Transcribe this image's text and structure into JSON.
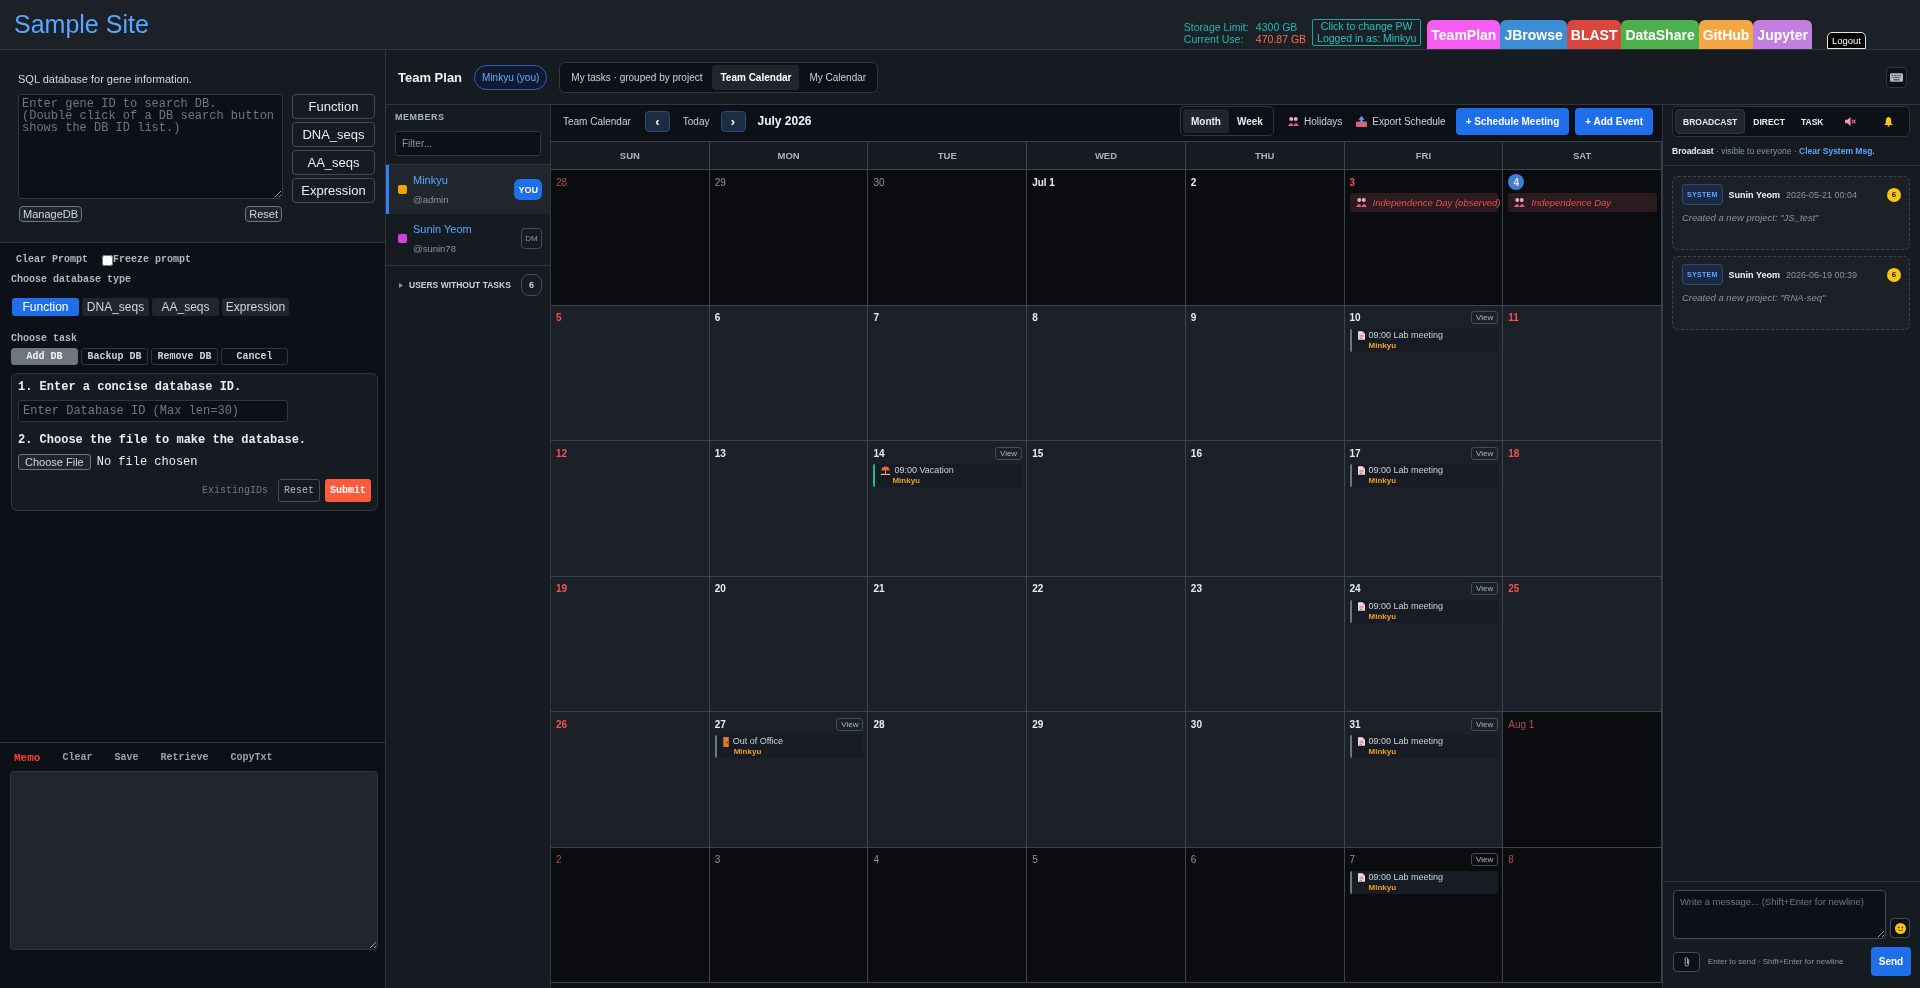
{
  "header": {
    "title": "Sample Site",
    "storage": [
      {
        "label": "Storage Limit:",
        "value": "4300 GB",
        "kind": "limit"
      },
      {
        "label": "Current Use:",
        "value": "470.87 GB",
        "kind": "use"
      }
    ],
    "account": {
      "action": "Click to change PW",
      "user": "Logged in as: Minkyu"
    },
    "apps": [
      {
        "label": "TeamPlan",
        "color": "#f55cf0"
      },
      {
        "label": "JBrowse",
        "color": "#3c8dd4"
      },
      {
        "label": "BLAST",
        "color": "#d9463e"
      },
      {
        "label": "DataShare",
        "color": "#4cb04c"
      },
      {
        "label": "GitHub",
        "color": "#f4a742"
      },
      {
        "label": "Jupyter",
        "color": "#c27fe0"
      }
    ],
    "logout": "Logout"
  },
  "gene_db": {
    "description": "SQL database for gene information.",
    "search": {
      "placeholder": "Enter gene ID to search DB.\n(Double click of a DB search button shows the DB ID list.)"
    },
    "search_buttons": [
      "Function",
      "DNA_seqs",
      "AA_seqs",
      "Expression"
    ],
    "manage": "ManageDB",
    "reset": "Reset"
  },
  "prompt_controls": {
    "clear": "Clear Prompt",
    "freeze": {
      "label": "Freeze prompt",
      "checked": false
    }
  },
  "db_type": {
    "label": "Choose database type",
    "options": [
      {
        "label": "Function",
        "selected": true
      },
      {
        "label": "DNA_seqs",
        "selected": false
      },
      {
        "label": "AA_seqs",
        "selected": false
      },
      {
        "label": "Expression",
        "selected": false
      }
    ]
  },
  "task": {
    "label": "Choose task",
    "options": [
      {
        "label": "Add DB",
        "selected": true
      },
      {
        "label": "Backup DB",
        "selected": false
      },
      {
        "label": "Remove DB",
        "selected": false
      },
      {
        "label": "Cancel",
        "selected": false
      }
    ]
  },
  "add_form": {
    "step_1": "1. Enter a concise database ID.",
    "id_field": {
      "placeholder": "Enter Database ID (Max len=30)"
    },
    "step_2": "2. Choose the file to make the database.",
    "file_button": "Choose File",
    "file_status": "No file chosen",
    "existing_ids": "ExistingIDs",
    "reset": "Reset",
    "submit": "Submit"
  },
  "memo": {
    "title": "Memo",
    "actions": [
      "Clear",
      "Save",
      "Retrieve",
      "CopyTxt"
    ]
  },
  "team_plan": {
    "title": "Team Plan",
    "user_chip": "Minkyu (you)",
    "views": [
      {
        "label": "My tasks · grouped by project",
        "selected": false
      },
      {
        "label": "Team Calendar",
        "selected": true
      },
      {
        "label": "My Calendar",
        "selected": false
      }
    ]
  },
  "members": {
    "title": "MEMBERS",
    "filter": {
      "placeholder": "Filter..."
    },
    "items": [
      {
        "name": "Minkyu",
        "handle": "@admin",
        "color": "#f0a30a",
        "kind": "self",
        "badge": "YOU",
        "selected": true
      },
      {
        "name": "Sunin Yeom",
        "handle": "@sunin78",
        "color": "#d63fd6",
        "kind": "other",
        "badge": "DM",
        "selected": false
      }
    ],
    "no_tasks": {
      "label": "USERS WITHOUT TASKS",
      "count": "6",
      "expanded": false
    }
  },
  "calendar": {
    "label": "Team Calendar",
    "prev": "‹",
    "today": "Today",
    "next": "›",
    "month": "July 2026",
    "modes": [
      {
        "label": "Month",
        "selected": true
      },
      {
        "label": "Week",
        "selected": false
      }
    ],
    "actions": [
      {
        "label": "Holidays",
        "kind": "holidays"
      },
      {
        "label": "Export Schedule",
        "kind": "export"
      }
    ],
    "buttons": [
      "+ Schedule Meeting",
      "+ Add Event"
    ],
    "weekdays": [
      "SUN",
      "MON",
      "TUE",
      "WED",
      "THU",
      "FRI",
      "SAT"
    ],
    "weeks": [
      [
        {
          "label": "28",
          "outside": true,
          "dimmed": true,
          "today": false
        },
        {
          "label": "29",
          "outside": true,
          "dimmed": true,
          "today": false
        },
        {
          "label": "30",
          "outside": true,
          "dimmed": true,
          "today": false
        },
        {
          "label": "Jul 1",
          "outside": false,
          "dimmed": true,
          "today": false
        },
        {
          "label": "2",
          "outside": false,
          "dimmed": true,
          "today": false
        },
        {
          "label": "3",
          "outside": false,
          "dimmed": true,
          "today": false,
          "events": [
            {
              "kind": "holiday",
              "text": "Independence Day (observed)"
            }
          ]
        },
        {
          "label": "4",
          "outside": false,
          "dimmed": true,
          "today": true,
          "events": [
            {
              "kind": "holiday",
              "text": "Independence Day"
            }
          ]
        }
      ],
      [
        {
          "label": "5",
          "outside": false,
          "dimmed": false,
          "today": false
        },
        {
          "label": "6",
          "outside": false,
          "dimmed": false,
          "today": false
        },
        {
          "label": "7",
          "outside": false,
          "dimmed": false,
          "today": false
        },
        {
          "label": "8",
          "outside": false,
          "dimmed": false,
          "today": false
        },
        {
          "label": "9",
          "outside": false,
          "dimmed": false,
          "today": false
        },
        {
          "label": "10",
          "outside": false,
          "dimmed": false,
          "today": false,
          "view": "View",
          "events": [
            {
              "kind": "meeting",
              "text": "09:00 Lab meeting",
              "owner": "Minkyu",
              "color": "#6e7681"
            }
          ]
        },
        {
          "label": "11",
          "outside": false,
          "dimmed": false,
          "today": false
        }
      ],
      [
        {
          "label": "12",
          "outside": false,
          "dimmed": false,
          "today": false
        },
        {
          "label": "13",
          "outside": false,
          "dimmed": false,
          "today": false
        },
        {
          "label": "14",
          "outside": false,
          "dimmed": false,
          "today": false,
          "view": "View",
          "events": [
            {
              "kind": "vacation",
              "text": "09:00 Vacation",
              "owner": "Minkyu",
              "color": "#1fb89a"
            }
          ]
        },
        {
          "label": "15",
          "outside": false,
          "dimmed": false,
          "today": false
        },
        {
          "label": "16",
          "outside": false,
          "dimmed": false,
          "today": false
        },
        {
          "label": "17",
          "outside": false,
          "dimmed": false,
          "today": false,
          "view": "View",
          "events": [
            {
              "kind": "meeting",
              "text": "09:00 Lab meeting",
              "owner": "Minkyu",
              "color": "#6e7681"
            }
          ]
        },
        {
          "label": "18",
          "outside": false,
          "dimmed": false,
          "today": false
        }
      ],
      [
        {
          "label": "19",
          "outside": false,
          "dimmed": false,
          "today": false
        },
        {
          "label": "20",
          "outside": false,
          "dimmed": false,
          "today": false
        },
        {
          "label": "21",
          "outside": false,
          "dimmed": false,
          "today": false
        },
        {
          "label": "22",
          "outside": false,
          "dimmed": false,
          "today": false
        },
        {
          "label": "23",
          "outside": false,
          "dimmed": false,
          "today": false
        },
        {
          "label": "24",
          "outside": false,
          "dimmed": false,
          "today": false,
          "view": "View",
          "events": [
            {
              "kind": "meeting",
              "text": "09:00 Lab meeting",
              "owner": "Minkyu",
              "color": "#6e7681"
            }
          ]
        },
        {
          "label": "25",
          "outside": false,
          "dimmed": false,
          "today": false
        }
      ],
      [
        {
          "label": "26",
          "outside": false,
          "dimmed": false,
          "today": false
        },
        {
          "label": "27",
          "outside": false,
          "dimmed": false,
          "today": false,
          "view": "View",
          "events": [
            {
              "kind": "away",
              "text": "Out of Office",
              "owner": "Minkyu",
              "color": "#6e7681"
            }
          ]
        },
        {
          "label": "28",
          "outside": false,
          "dimmed": false,
          "today": false
        },
        {
          "label": "29",
          "outside": false,
          "dimmed": false,
          "today": false
        },
        {
          "label": "30",
          "outside": false,
          "dimmed": false,
          "today": false
        },
        {
          "label": "31",
          "outside": false,
          "dimmed": false,
          "today": false,
          "view": "View",
          "events": [
            {
              "kind": "meeting",
              "text": "09:00 Lab meeting",
              "owner": "Minkyu",
              "color": "#6e7681"
            }
          ]
        },
        {
          "label": "Aug 1",
          "outside": true,
          "dimmed": true,
          "today": false
        }
      ],
      [
        {
          "label": "2",
          "outside": true,
          "dimmed": true,
          "today": false
        },
        {
          "label": "3",
          "outside": true,
          "dimmed": true,
          "today": false
        },
        {
          "label": "4",
          "outside": true,
          "dimmed": true,
          "today": false
        },
        {
          "label": "5",
          "outside": true,
          "dimmed": true,
          "today": false
        },
        {
          "label": "6",
          "outside": true,
          "dimmed": true,
          "today": false
        },
        {
          "label": "7",
          "outside": true,
          "dimmed": true,
          "today": false,
          "view": "View",
          "events": [
            {
              "kind": "meeting",
              "text": "09:00 Lab meeting",
              "owner": "Minkyu",
              "color": "#6e7681"
            }
          ]
        },
        {
          "label": "8",
          "outside": true,
          "dimmed": true,
          "today": false
        }
      ]
    ]
  },
  "chat": {
    "tabs": [
      {
        "label": "BROADCAST",
        "kind": "text",
        "selected": true
      },
      {
        "label": "DIRECT",
        "kind": "text",
        "selected": false
      },
      {
        "label": "TASK",
        "kind": "text",
        "selected": false
      },
      {
        "kind": "mute",
        "selected": false
      },
      {
        "kind": "bell",
        "selected": false
      }
    ],
    "note": {
      "text": "**Broadcast** · visible to everyone ·",
      "link": "Clear System Msg."
    },
    "messages": [
      {
        "tag": "SYSTEM",
        "sender": "Sunin Yeom",
        "time": "2026-05-21 00:04",
        "count": "6",
        "text": "Created a new project: \"JS_test\""
      },
      {
        "tag": "SYSTEM",
        "sender": "Sunin Yeom",
        "time": "2026-06-19 00:39",
        "count": "6",
        "text": "Created a new project: \"RNA-seq\""
      }
    ],
    "composer": {
      "placeholder": "Write a message... (Shift+Enter for newline)",
      "hint": "Enter to send · Shift+Enter for newline",
      "send": "Send"
    }
  }
}
